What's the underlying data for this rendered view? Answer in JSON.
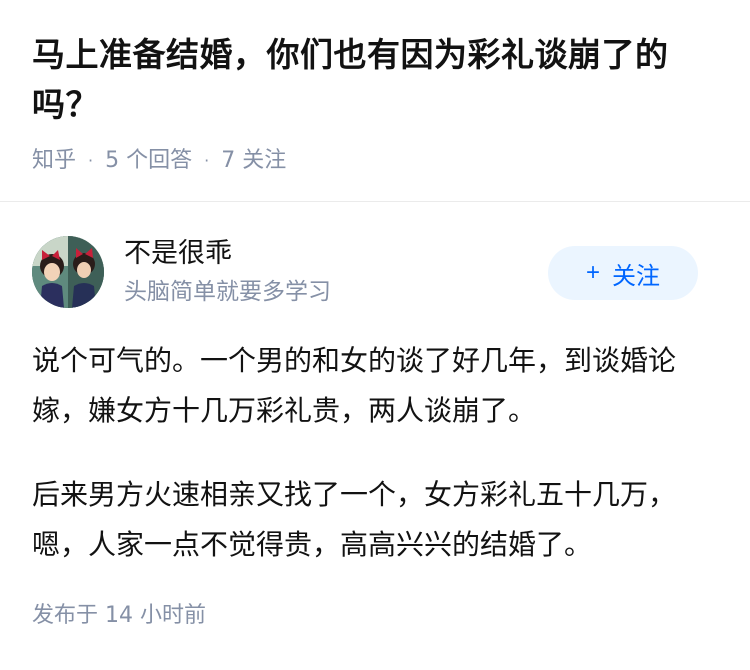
{
  "question": {
    "title": "马上准备结婚，你们也有因为彩礼谈崩了的吗？",
    "source": "知乎",
    "answers_count": "5 个回答",
    "followers_count": "7 关注",
    "separator": "·"
  },
  "author": {
    "name": "不是很乖",
    "bio": "头脑简单就要多学习",
    "follow_plus": "+",
    "follow_label": "关注",
    "avatar_icon": "anime-girl-avatar-icon"
  },
  "answer": {
    "paragraphs": [
      "说个可气的。一个男的和女的谈了好几年，到谈婚论嫁，嫌女方十几万彩礼贵，两人谈崩了。",
      "后来男方火速相亲又找了一个，女方彩礼五十几万，嗯，人家一点不觉得贵，高高兴兴的结婚了。"
    ],
    "published": "发布于 14 小时前"
  },
  "colors": {
    "title": "#121212",
    "meta": "#8590a6",
    "accent": "#0066ff",
    "follow_bg": "#ebf5ff",
    "divider": "#ebebeb"
  }
}
